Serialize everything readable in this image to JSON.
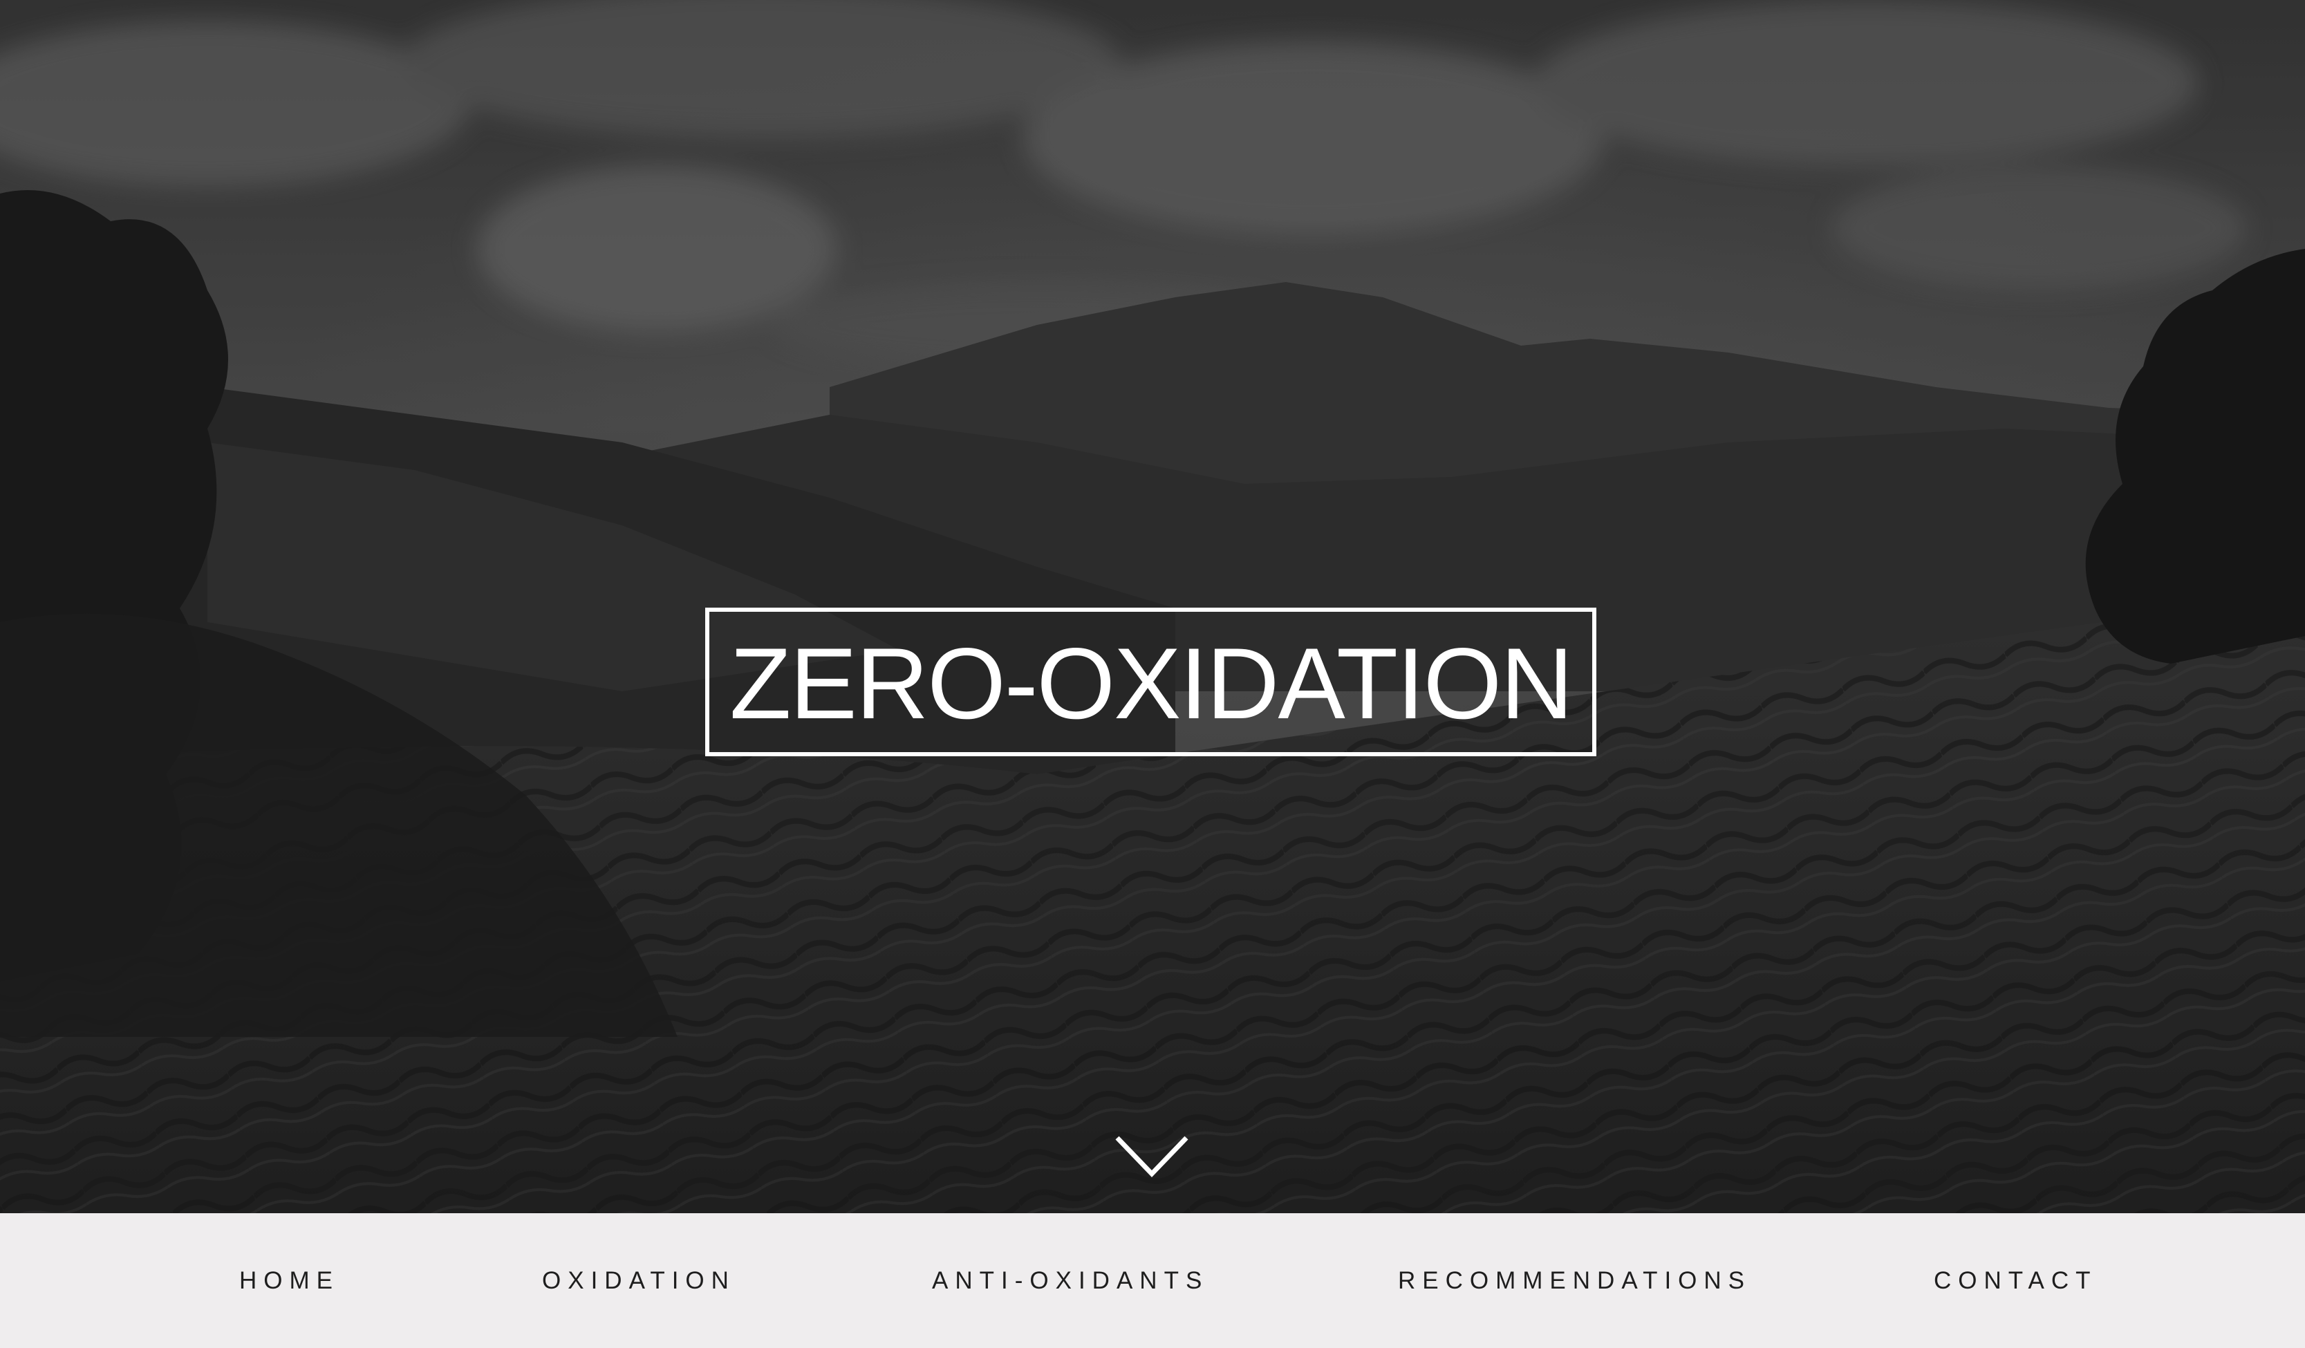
{
  "hero": {
    "title": "ZERO-OXIDATION",
    "scroll_icon": "chevron-down-icon",
    "background_image": "monochrome-tea-plantation-landscape"
  },
  "nav": {
    "items": [
      {
        "label": "HOME"
      },
      {
        "label": "OXIDATION"
      },
      {
        "label": "ANTI-OXIDANTS"
      },
      {
        "label": "RECOMMENDATIONS"
      },
      {
        "label": "CONTACT"
      }
    ]
  },
  "colors": {
    "nav_background": "#efedee",
    "nav_text": "#1e1e1e",
    "title_text": "#ffffff"
  }
}
